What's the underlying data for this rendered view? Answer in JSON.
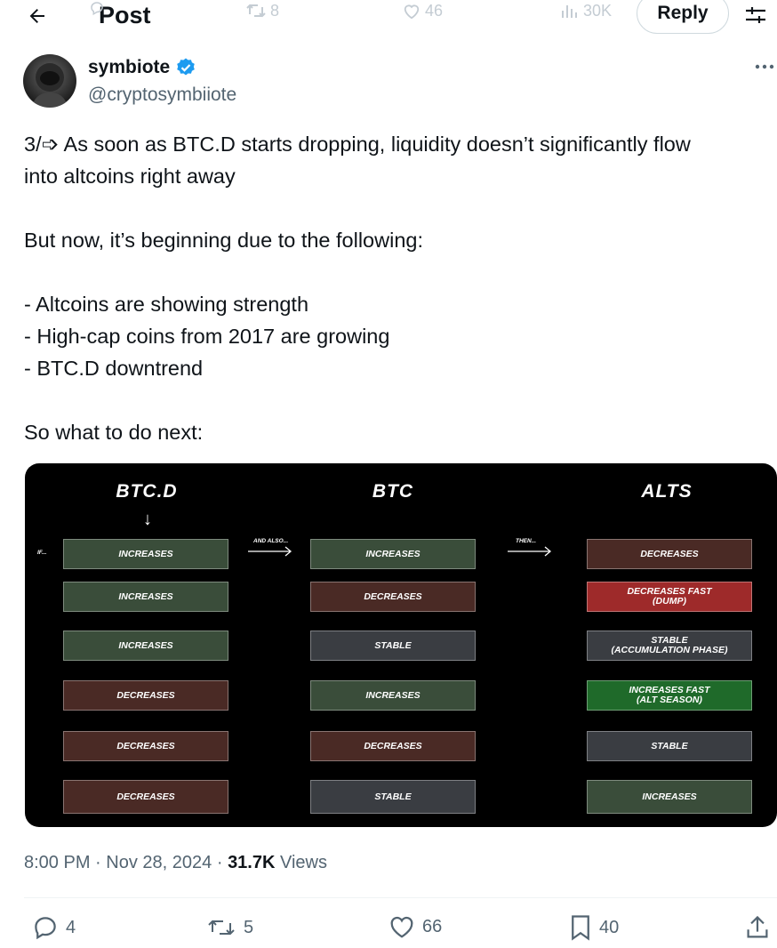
{
  "header": {
    "title": "Post",
    "ghost_retweets": "8",
    "ghost_likes": "46",
    "ghost_views": "30K",
    "reply_label": "Reply"
  },
  "author": {
    "display_name": "symbiote",
    "handle": "@cryptosymbiiote",
    "verified": true
  },
  "tweet": {
    "line1": "3/➩ As soon as BTC.D starts dropping, liquidity doesn’t significantly flow",
    "line2": "into altcoins right away",
    "line3": "But now, it’s beginning due to the following:",
    "bullet1": "- Altcoins are showing strength",
    "bullet2": "- High-cap coins from 2017 are growing",
    "bullet3": "- BTC.D downtrend",
    "line4": "So what to do next:"
  },
  "media": {
    "headers": {
      "btcd": "BTC.D",
      "btc": "BTC",
      "alts": "ALTS"
    },
    "arrow_down": "↓",
    "if_label": "IF...",
    "and_also_label": "AND ALSO...",
    "then_label": "THEN...",
    "rows": [
      {
        "btcd": "INCREASES",
        "btc": "INCREASES",
        "alts": "DECREASES"
      },
      {
        "btcd": "INCREASES",
        "btc": "DECREASES",
        "alts": "DECREASES FAST\n(DUMP)"
      },
      {
        "btcd": "INCREASES",
        "btc": "STABLE",
        "alts": "STABLE\n(ACCUMULATION PHASE)"
      },
      {
        "btcd": "DECREASES",
        "btc": "INCREASES",
        "alts": "INCREASES FAST\n(ALT SEASON)"
      },
      {
        "btcd": "DECREASES",
        "btc": "DECREASES",
        "alts": "STABLE"
      },
      {
        "btcd": "DECREASES",
        "btc": "STABLE",
        "alts": "INCREASES"
      }
    ]
  },
  "meta": {
    "time": "8:00 PM",
    "sep1": "·",
    "date": "Nov 28, 2024",
    "sep2": "·",
    "views_count": "31.7K",
    "views_label": "Views"
  },
  "actions": {
    "replies": "4",
    "reposts": "5",
    "likes": "66",
    "bookmarks": "40"
  },
  "colors": {
    "text": "#0f1419",
    "secondary": "#536471",
    "verified": "#1d9bf0",
    "cell_green": "#3a4d3a",
    "cell_brown": "#4a2a25",
    "cell_gray": "#3a3d42",
    "cell_red": "#9e2a2a",
    "cell_bright_green": "#1f6a2a"
  }
}
